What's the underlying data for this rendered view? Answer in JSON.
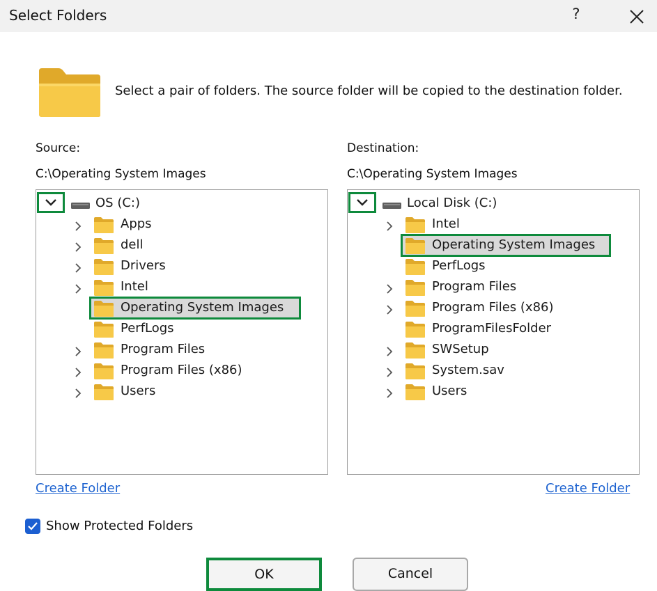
{
  "window": {
    "title": "Select Folders",
    "help_label": "?"
  },
  "instructions": "Select a pair of folders.  The source folder will be copied to the destination folder.",
  "source": {
    "label": "Source:",
    "path": "C:\\Operating System Images",
    "root": "OS (C:)",
    "items": [
      {
        "label": "Apps",
        "expandable": true
      },
      {
        "label": "dell",
        "expandable": true
      },
      {
        "label": "Drivers",
        "expandable": true
      },
      {
        "label": "Intel",
        "expandable": true
      },
      {
        "label": "Operating System Images",
        "expandable": false,
        "selected": true
      },
      {
        "label": "PerfLogs",
        "expandable": false
      },
      {
        "label": "Program Files",
        "expandable": true
      },
      {
        "label": "Program Files (x86)",
        "expandable": true
      },
      {
        "label": "Users",
        "expandable": true
      }
    ],
    "create_folder": "Create Folder"
  },
  "destination": {
    "label": "Destination:",
    "path": "C:\\Operating System Images",
    "root": "Local Disk (C:)",
    "items": [
      {
        "label": "Intel",
        "expandable": true
      },
      {
        "label": "Operating System Images",
        "expandable": false,
        "selected": true
      },
      {
        "label": "PerfLogs",
        "expandable": false
      },
      {
        "label": "Program Files",
        "expandable": true
      },
      {
        "label": "Program Files (x86)",
        "expandable": true
      },
      {
        "label": "ProgramFilesFolder",
        "expandable": false
      },
      {
        "label": "SWSetup",
        "expandable": true
      },
      {
        "label": "System.sav",
        "expandable": true
      },
      {
        "label": "Users",
        "expandable": true
      }
    ],
    "create_folder": "Create Folder"
  },
  "show_protected": {
    "label": "Show Protected Folders",
    "checked": true
  },
  "buttons": {
    "ok": "OK",
    "cancel": "Cancel"
  },
  "colors": {
    "accent_green": "#0e8a3c",
    "link_blue": "#1e63d0",
    "folder_yellow": "#f7c948",
    "checkbox_blue": "#1c5fd1"
  },
  "icons": [
    "folder-icon",
    "drive-icon",
    "chevron-right-icon",
    "chevron-down-icon",
    "close-icon",
    "checkmark-icon"
  ]
}
